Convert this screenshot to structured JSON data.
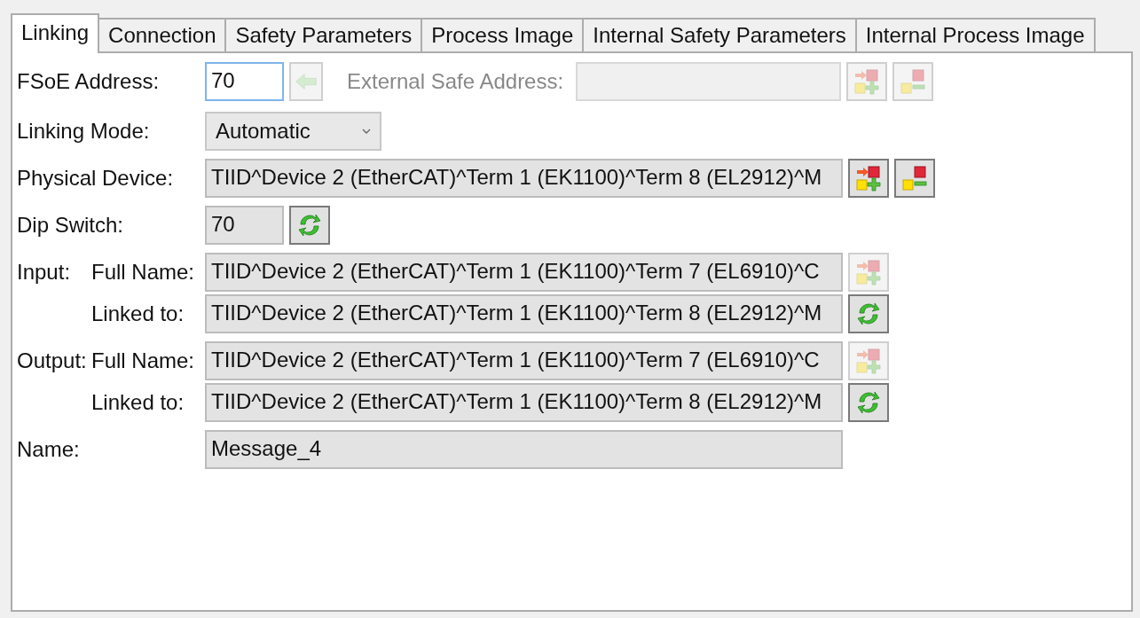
{
  "tabs": [
    {
      "label": "Linking",
      "selected": true
    },
    {
      "label": "Connection",
      "selected": false
    },
    {
      "label": "Safety Parameters",
      "selected": false
    },
    {
      "label": "Process Image",
      "selected": false
    },
    {
      "label": "Internal Safety Parameters",
      "selected": false
    },
    {
      "label": "Internal Process Image",
      "selected": false
    }
  ],
  "rows": [
    {
      "kind": "address",
      "label": "FSoE Address:",
      "field": {
        "value": "70",
        "focused": true,
        "disabled": false
      },
      "buttons": [
        {
          "kind": "arrow",
          "disabled": true
        }
      ],
      "external": {
        "label": "External Safe Address:",
        "disabled": true,
        "buttons": [
          {
            "kind": "link_add",
            "disabled": true
          },
          {
            "kind": "link_remove",
            "disabled": true
          }
        ]
      }
    },
    {
      "kind": "dropdown",
      "label": "Linking Mode:",
      "value": "Automatic"
    },
    {
      "kind": "wide",
      "label": "Physical Device:",
      "field": {
        "value": "TIID^Device 2 (EtherCAT)^Term 1 (EK1100)^Term 8 (EL2912)^M",
        "focused": false,
        "disabled": false
      },
      "buttons": [
        {
          "kind": "link_add",
          "disabled": false
        },
        {
          "kind": "link_remove",
          "disabled": false
        }
      ]
    },
    {
      "kind": "short",
      "label": "Dip Switch:",
      "field": {
        "value": "70",
        "focused": false,
        "disabled": false
      },
      "buttons": [
        {
          "kind": "refresh",
          "disabled": false
        }
      ]
    },
    {
      "kind": "wide",
      "group": "Input:",
      "label": "Full Name:",
      "field": {
        "value": "TIID^Device 2 (EtherCAT)^Term 1 (EK1100)^Term 7 (EL6910)^C",
        "focused": false,
        "disabled": false
      },
      "buttons": [
        {
          "kind": "link_add",
          "disabled": true
        }
      ]
    },
    {
      "kind": "wide",
      "sub": true,
      "label": "Linked to:",
      "field": {
        "value": "TIID^Device 2 (EtherCAT)^Term 1 (EK1100)^Term 8 (EL2912)^M",
        "focused": false,
        "disabled": false
      },
      "buttons": [
        {
          "kind": "refresh",
          "disabled": false
        }
      ]
    },
    {
      "kind": "wide",
      "group": "Output:",
      "label": "Full Name:",
      "field": {
        "value": "TIID^Device 2 (EtherCAT)^Term 1 (EK1100)^Term 7 (EL6910)^C",
        "focused": false,
        "disabled": false
      },
      "buttons": [
        {
          "kind": "link_add",
          "disabled": true
        }
      ]
    },
    {
      "kind": "wide",
      "sub": true,
      "label": "Linked to:",
      "field": {
        "value": "TIID^Device 2 (EtherCAT)^Term 1 (EK1100)^Term 8 (EL2912)^M",
        "focused": false,
        "disabled": false
      },
      "buttons": [
        {
          "kind": "refresh",
          "disabled": false
        }
      ]
    },
    {
      "kind": "wide",
      "label": "Name:",
      "field": {
        "value": "Message_4",
        "focused": false,
        "disabled": false
      },
      "buttons": []
    }
  ]
}
